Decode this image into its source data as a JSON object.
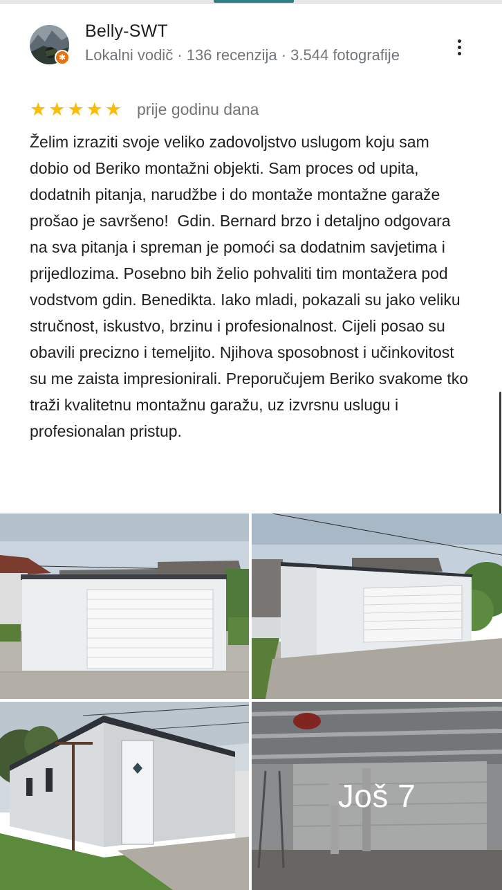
{
  "author": {
    "name": "Belly-SWT",
    "meta": "Lokalni vodič · 136 recenzija · 3.544 fotografije",
    "badge_color": "#e8710a"
  },
  "review": {
    "rating": 5,
    "stars": [
      "★",
      "★",
      "★",
      "★",
      "★"
    ],
    "date": "prije godinu dana",
    "text": "Želim izraziti svoje veliko zadovoljstvo uslugom koju sam dobio od Beriko montažni objekti. Sam proces od upita, dodatnih pitanja, narudžbe i do montaže montažne garaže prošao je savršeno!  Gdin. Bernard brzo i detaljno odgovara na sva pitanja i spreman je pomoći sa dodatnim savjetima i prijedlozima. Posebno bih želio pohvaliti tim montažera pod vodstvom gdin. Benedikta. Iako mladi, pokazali su jako veliku stručnost, iskustvo, brzinu i profesionalnost. Cijeli posao su obavili precizno i temeljito. Njihova sposobnost i učinkovitost su me zaista impresionirali. Preporučujem Beriko svakome tko traži kvalitetnu montažnu garažu, uz izvrsnu uslugu i profesionalan pristup."
  },
  "photos": {
    "more_label": "Još 7",
    "star_color": "#fbbc04"
  }
}
